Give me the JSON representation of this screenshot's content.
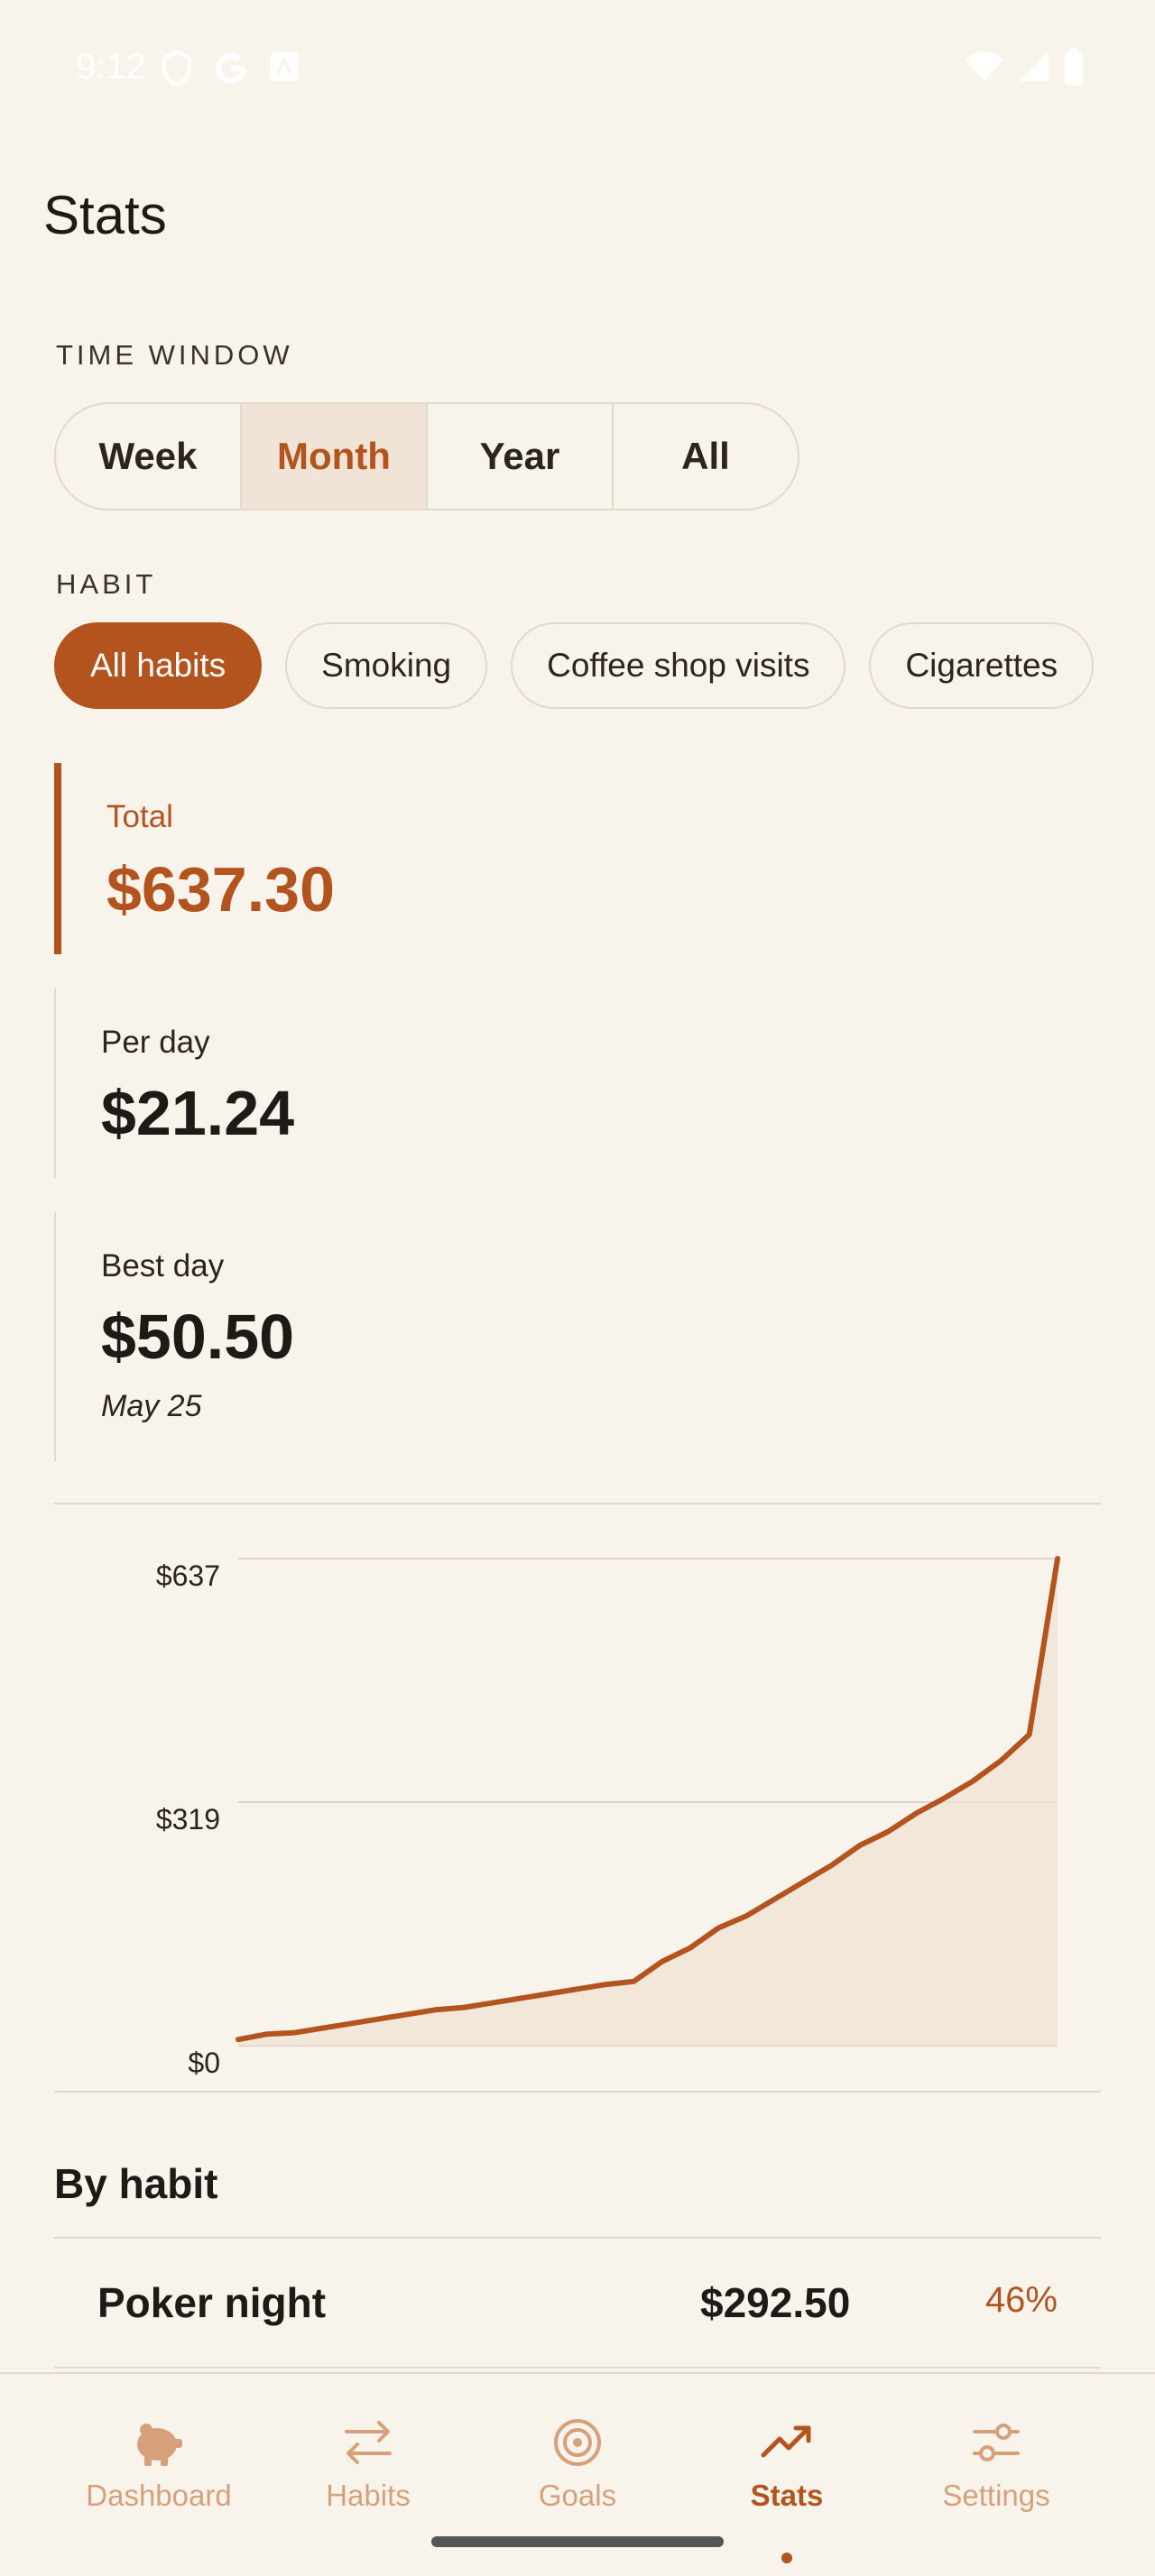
{
  "status_bar": {
    "time": "9:12"
  },
  "page": {
    "title": "Stats"
  },
  "time_window": {
    "label": "TIME WINDOW",
    "options": [
      "Week",
      "Month",
      "Year",
      "All"
    ],
    "selected": "Month"
  },
  "habit_filter": {
    "label": "HABIT",
    "chips": [
      "All habits",
      "Smoking",
      "Coffee shop visits",
      "Cigarettes"
    ],
    "selected": "All habits"
  },
  "stats": {
    "total_label": "Total",
    "total_value": "$637.30",
    "per_day_label": "Per day",
    "per_day_value": "$21.24",
    "best_day_label": "Best day",
    "best_day_value": "$50.50",
    "best_day_date": "May 25"
  },
  "chart_data": {
    "type": "area",
    "title": "",
    "xlabel": "",
    "ylabel": "",
    "yticks": [
      "$0",
      "$319",
      "$637"
    ],
    "ylim": [
      0,
      637.3
    ],
    "x": [
      1,
      2,
      3,
      4,
      5,
      6,
      7,
      8,
      9,
      10,
      11,
      12,
      13,
      14,
      15,
      16,
      17,
      18,
      19,
      20,
      21,
      22,
      23,
      24,
      25,
      26,
      27,
      28,
      29,
      30
    ],
    "series": [
      {
        "values": [
          8,
          15,
          17,
          23,
          29,
          35,
          41,
          47,
          50,
          56,
          62,
          68,
          74,
          80,
          84,
          110,
          128,
          154,
          170,
          192,
          214,
          236,
          262,
          280,
          304,
          324,
          346,
          373,
          407,
          637.3
        ]
      }
    ],
    "colors": {
      "line": "#b3541e",
      "fill": "#f1e4d6"
    },
    "grid": true
  },
  "by_habit": {
    "title": "By habit",
    "rows": [
      {
        "name": "Poker night",
        "amount": "$292.50",
        "percent": "46%"
      }
    ]
  },
  "bottom_nav": {
    "items": [
      {
        "label": "Dashboard",
        "icon": "pig-icon"
      },
      {
        "label": "Habits",
        "icon": "swap-arrows-icon"
      },
      {
        "label": "Goals",
        "icon": "target-icon"
      },
      {
        "label": "Stats",
        "icon": "trending-up-icon"
      },
      {
        "label": "Settings",
        "icon": "sliders-icon"
      }
    ],
    "active": "Stats"
  },
  "theme": {
    "accent": "#b3541e",
    "background": "#f8f4ec",
    "muted_accent": "#d5a07a"
  }
}
